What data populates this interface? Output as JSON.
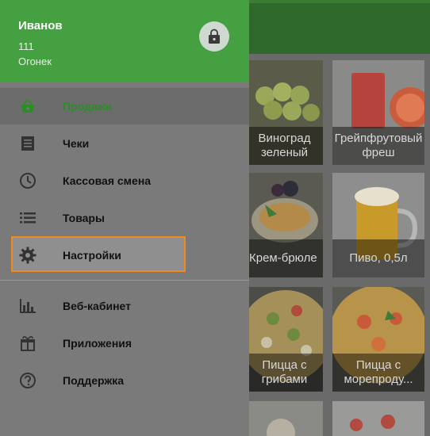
{
  "user": {
    "name": "Иванов",
    "number": "111",
    "shop": "Огонек"
  },
  "menu": [
    {
      "label": "Продажи",
      "icon": "basket-icon",
      "active": true
    },
    {
      "label": "Чеки",
      "icon": "receipt-icon"
    },
    {
      "label": "Кассовая смена",
      "icon": "clock-icon"
    },
    {
      "label": "Товары",
      "icon": "list-icon"
    },
    {
      "label": "Настройки",
      "icon": "gear-icon",
      "highlighted": true
    },
    {
      "label": "Веб-кабинет",
      "icon": "bar-chart-icon"
    },
    {
      "label": "Приложения",
      "icon": "gift-icon"
    },
    {
      "label": "Поддержка",
      "icon": "help-icon"
    }
  ],
  "products": [
    {
      "label": "Виноград зеленый"
    },
    {
      "label": "Грейпфрутовый фреш"
    },
    {
      "label": "Крем-брюле"
    },
    {
      "label": "Пиво, 0,5л"
    },
    {
      "label": "Пицца с грибами"
    },
    {
      "label": "Пицца с морепроду..."
    }
  ],
  "colors": {
    "accent": "#44a040",
    "highlight": "#f08a1c"
  }
}
